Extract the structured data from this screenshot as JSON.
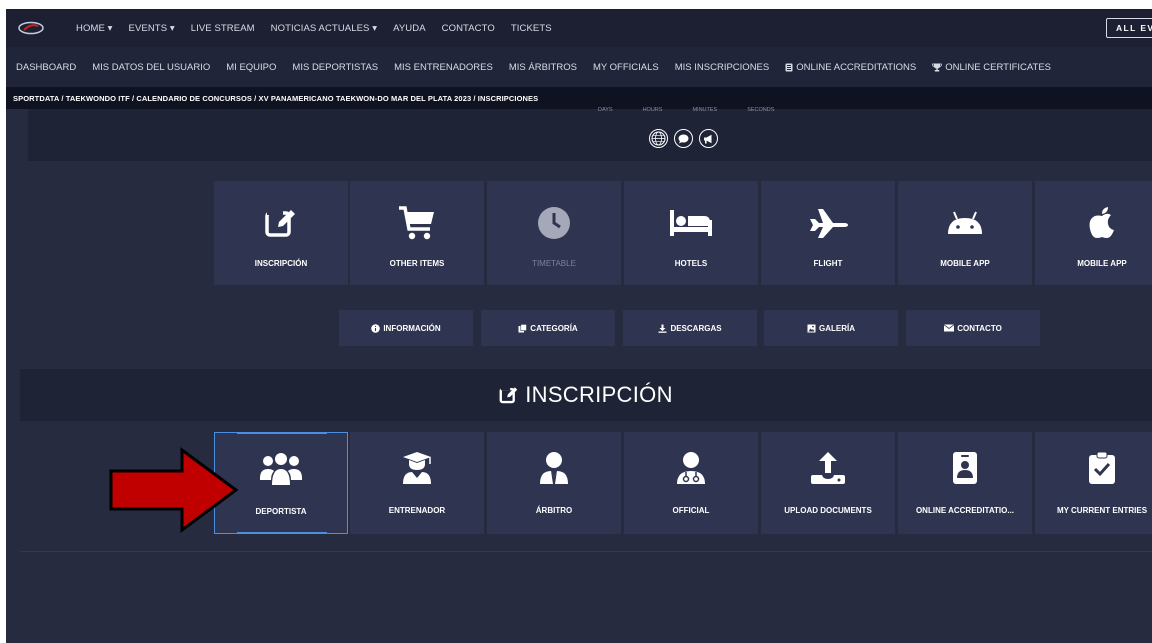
{
  "nav": {
    "items": [
      "HOME ▾",
      "EVENTS ▾",
      "LIVE STREAM",
      "NOTICIAS ACTUALES ▾",
      "AYUDA",
      "CONTACTO",
      "TICKETS"
    ],
    "all_events": "ALL EV"
  },
  "subnav": {
    "items": [
      "DASHBOARD",
      "MIS DATOS DEL USUARIO",
      "MI EQUIPO",
      "MIS DEPORTISTAS",
      "MIS ENTRENADORES",
      "MIS ÁRBITROS",
      "MY OFFICIALS",
      "MIS INSCRIPCIONES"
    ],
    "accreditations": "ONLINE ACCREDITATIONS",
    "certificates": "ONLINE CERTIFICATES"
  },
  "breadcrumb": "SPORTDATA / TAEKWONDO ITF / CALENDARIO DE CONCURSOS / XV PANAMERICANO TAEKWON-DO MAR DEL PLATA 2023 / INSCRIPCIONES",
  "countdown": [
    "DAYS",
    "HOURS",
    "MINUTES",
    "SECONDS"
  ],
  "event_tiles": [
    {
      "label": "INSCRIPCIÓN",
      "icon": "edit-icon",
      "muted": false
    },
    {
      "label": "OTHER ITEMS",
      "icon": "cart-icon",
      "muted": false
    },
    {
      "label": "TIMETABLE",
      "icon": "clock-icon",
      "muted": true
    },
    {
      "label": "HOTELS",
      "icon": "bed-icon",
      "muted": false
    },
    {
      "label": "FLIGHT",
      "icon": "plane-icon",
      "muted": false
    },
    {
      "label": "MOBILE APP",
      "icon": "android-icon",
      "muted": false
    },
    {
      "label": "MOBILE APP",
      "icon": "apple-icon",
      "muted": false
    }
  ],
  "info_buttons": [
    "INFORMACIÓN",
    "CATEGORÍA",
    "DESCARGAS",
    "GALERÍA",
    "CONTACTO"
  ],
  "section_title": "INSCRIPCIÓN",
  "registration_tiles": [
    {
      "label": "DEPORTISTA",
      "icon": "athletes-icon"
    },
    {
      "label": "ENTRENADOR",
      "icon": "coach-icon"
    },
    {
      "label": "ÁRBITRO",
      "icon": "referee-icon"
    },
    {
      "label": "OFFICIAL",
      "icon": "official-icon"
    },
    {
      "label": "UPLOAD DOCUMENTS",
      "icon": "upload-icon"
    },
    {
      "label": "ONLINE ACCREDITATIO...",
      "icon": "id-badge-icon"
    },
    {
      "label": "MY CURRENT ENTRIES",
      "icon": "clipboard-check-icon"
    }
  ],
  "colors": {
    "background": "#262b40",
    "tile": "#2f3450",
    "nav": "#1c2032",
    "selected_border": "#4a90e2",
    "annotation_arrow": "#c00000"
  }
}
